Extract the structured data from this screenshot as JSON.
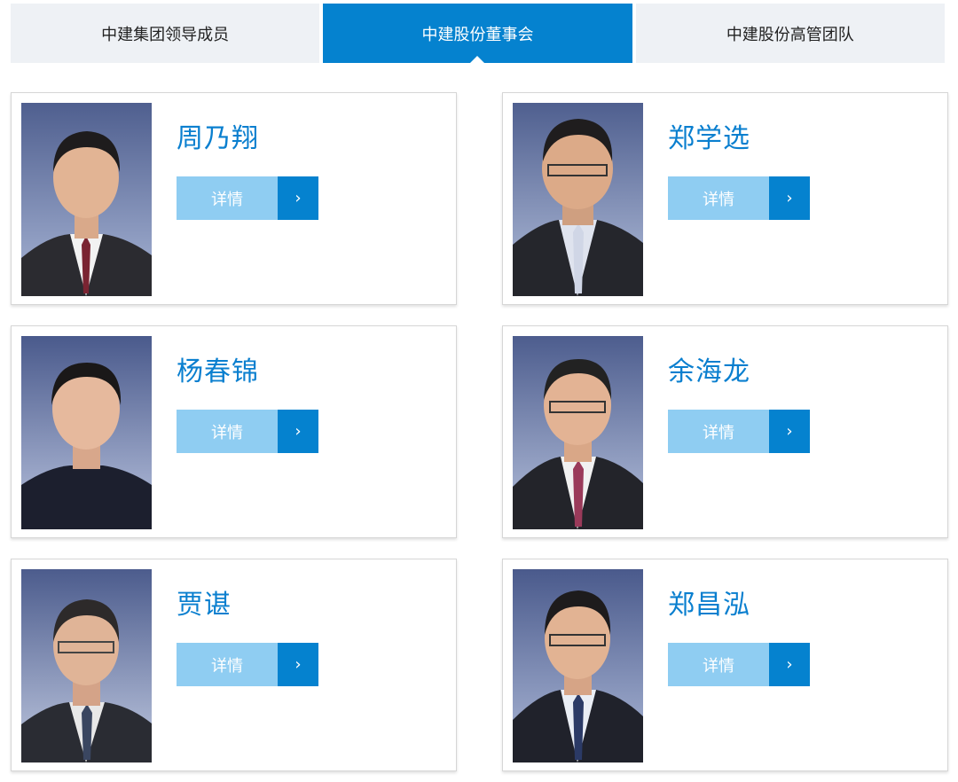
{
  "tabs": [
    {
      "label": "中建集团领导成员",
      "active": false
    },
    {
      "label": "中建股份董事会",
      "active": true
    },
    {
      "label": "中建股份高管团队",
      "active": false
    }
  ],
  "members": [
    {
      "name": "周乃翔",
      "detail_label": "详情",
      "arrow": "›"
    },
    {
      "name": "郑学选",
      "detail_label": "详情",
      "arrow": "›"
    },
    {
      "name": "杨春锦",
      "detail_label": "详情",
      "arrow": "›"
    },
    {
      "name": "余海龙",
      "detail_label": "详情",
      "arrow": "›"
    },
    {
      "name": "贾谌",
      "detail_label": "详情",
      "arrow": "›"
    },
    {
      "name": "郑昌泓",
      "detail_label": "详情",
      "arrow": "›"
    }
  ],
  "colors": {
    "accent": "#0582cf",
    "light_accent": "#8fcdf2",
    "name_color": "#0a7fcf",
    "tab_bg": "#eef1f5"
  }
}
